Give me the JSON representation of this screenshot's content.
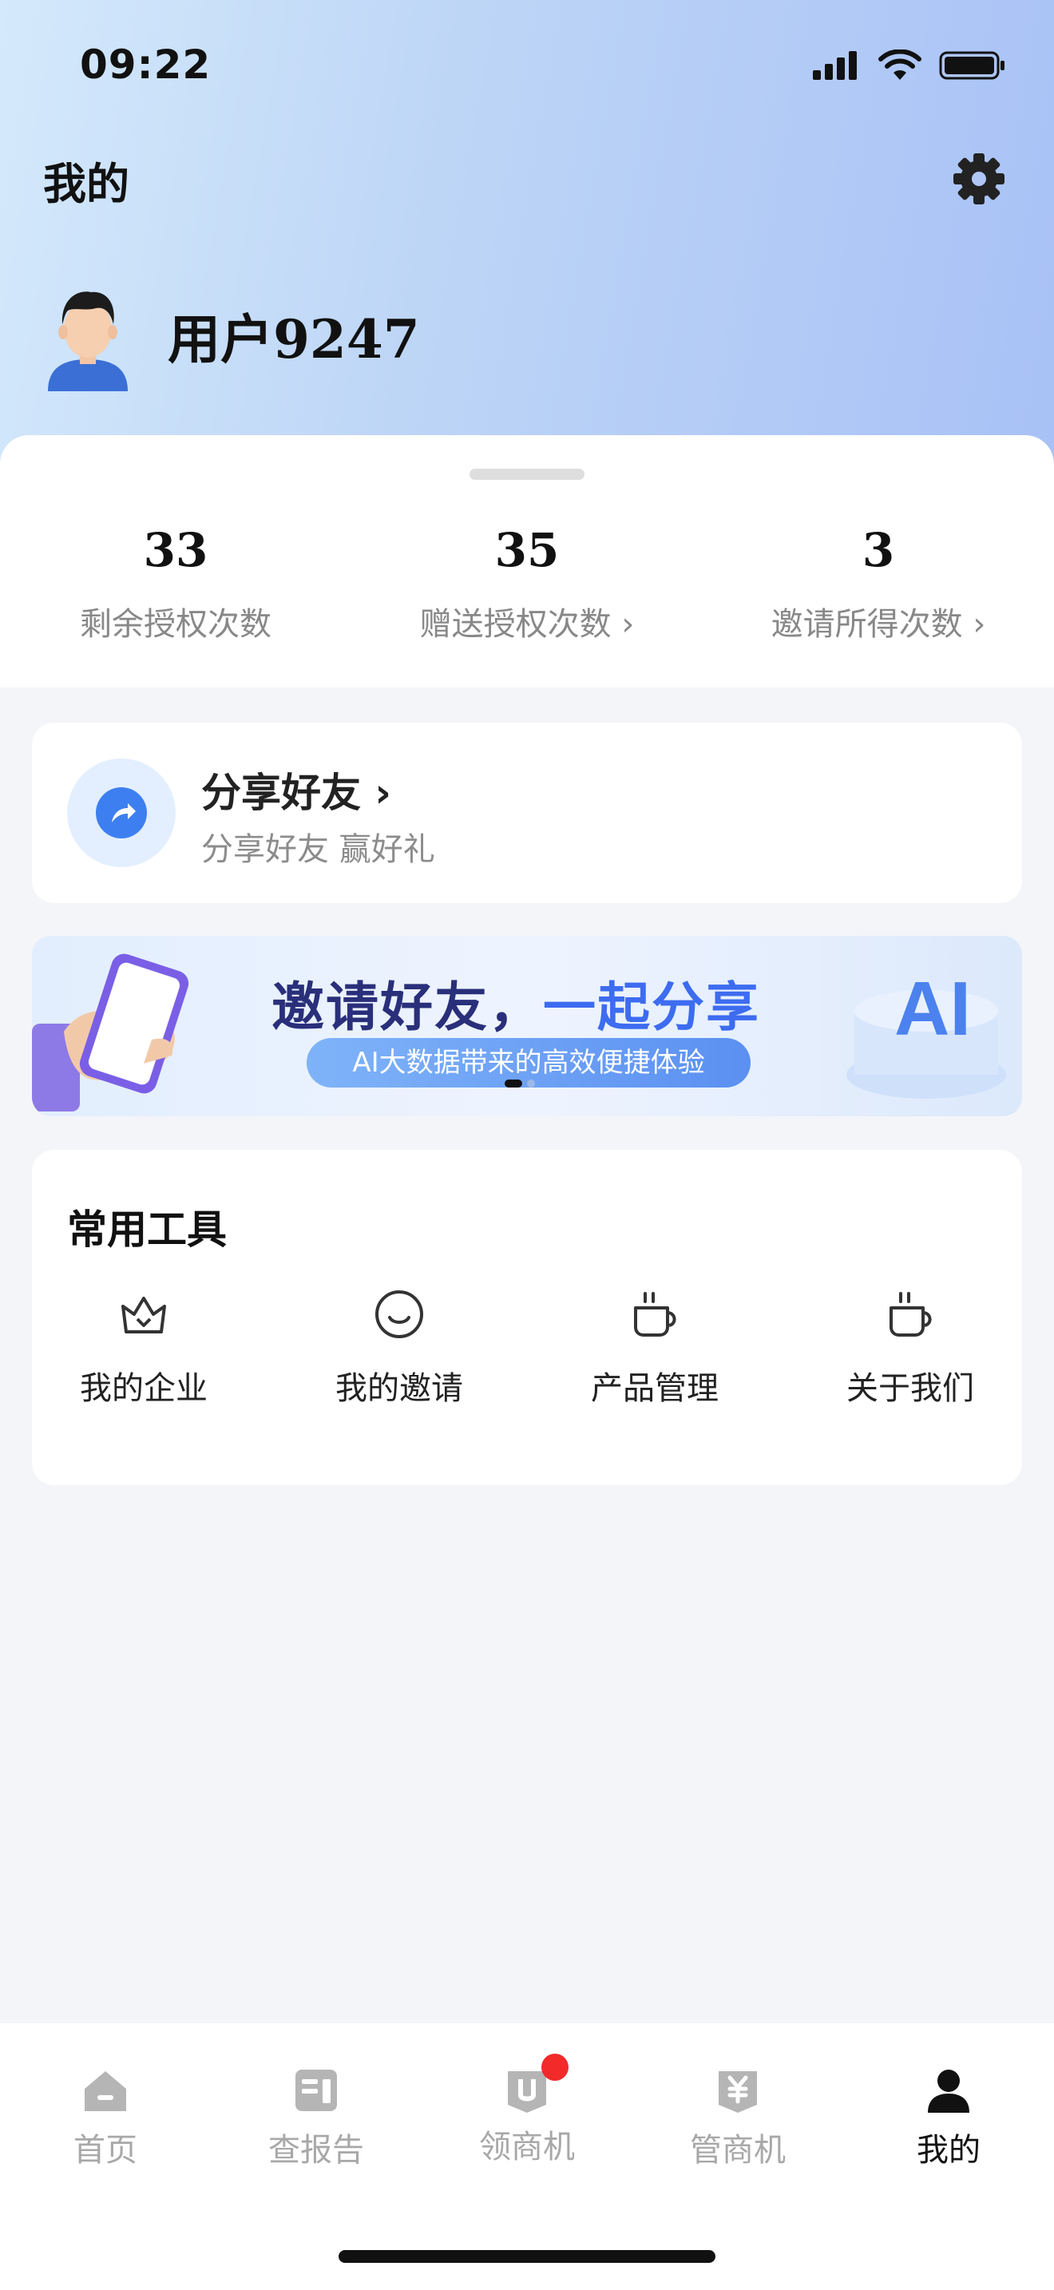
{
  "status_bar": {
    "time": "09:22"
  },
  "header": {
    "title": "我的"
  },
  "profile": {
    "username": "用户9247"
  },
  "stats": [
    {
      "value": "33",
      "label": "剩余授权次数"
    },
    {
      "value": "35",
      "label": "赠送授权次数 ›"
    },
    {
      "value": "3",
      "label": "邀请所得次数 ›"
    }
  ],
  "share": {
    "title": "分享好友 ›",
    "subtitle": "分享好友 赢好礼"
  },
  "banner": {
    "title_main": "邀请好友，",
    "title_highlight": "一起分享",
    "tagline": "AI大数据带来的高效便捷体验",
    "badge_text": "AI"
  },
  "tools": {
    "title": "常用工具",
    "items": [
      {
        "label": "我的企业",
        "icon": "crown-icon"
      },
      {
        "label": "我的邀请",
        "icon": "smile-icon"
      },
      {
        "label": "产品管理",
        "icon": "cup-icon"
      },
      {
        "label": "关于我们",
        "icon": "cup-icon"
      }
    ]
  },
  "tabbar": {
    "items": [
      {
        "label": "首页",
        "icon": "home-icon",
        "active": false
      },
      {
        "label": "查报告",
        "icon": "report-icon",
        "active": false
      },
      {
        "label": "领商机",
        "icon": "opportunity-icon",
        "active": false,
        "badge": true
      },
      {
        "label": "管商机",
        "icon": "manage-icon",
        "active": false
      },
      {
        "label": "我的",
        "icon": "person-icon",
        "active": true
      }
    ]
  },
  "colors": {
    "accent": "#3d7ff0",
    "badge": "#f22a2a",
    "banner_title": "#2a2f7a"
  }
}
